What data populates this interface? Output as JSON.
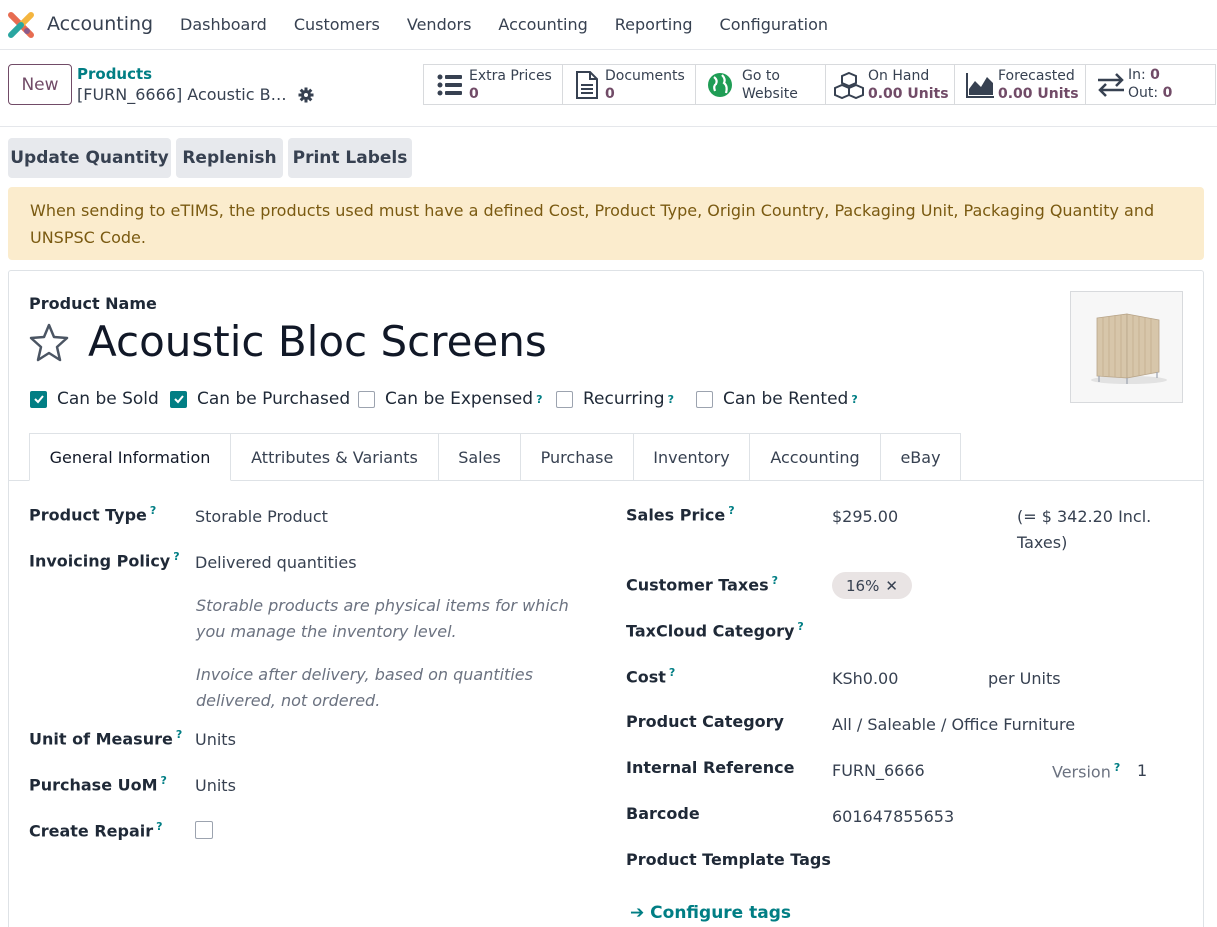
{
  "nav": {
    "app_name": "Accounting",
    "menu": [
      "Dashboard",
      "Customers",
      "Vendors",
      "Accounting",
      "Reporting",
      "Configuration"
    ]
  },
  "control_panel": {
    "new_label": "New",
    "breadcrumb_parent": "Products",
    "breadcrumb_current": "[FURN_6666] Acoustic B…",
    "smart_buttons": {
      "extra_prices": {
        "label": "Extra Prices",
        "value": "0"
      },
      "documents": {
        "label": "Documents",
        "value": "0"
      },
      "website": {
        "line1": "Go to",
        "line2": "Website"
      },
      "on_hand": {
        "label": "On Hand",
        "value": "0.00 Units"
      },
      "forecasted": {
        "label": "Forecasted",
        "value": "0.00 Units"
      },
      "in_out": {
        "in_label": "In:",
        "in_value": "0",
        "out_label": "Out:",
        "out_value": "0"
      }
    }
  },
  "actions": {
    "update_quantity": "Update Quantity",
    "replenish": "Replenish",
    "print_labels": "Print Labels"
  },
  "alert": "When sending to eTIMS, the products used must have a defined Cost, Product Type, Origin Country, Packaging Unit, Packaging Quantity and UNSPSC Code.",
  "product": {
    "name_label": "Product Name",
    "name": "Acoustic Bloc Screens",
    "checkboxes": [
      {
        "label": "Can be Sold",
        "checked": true,
        "help": false
      },
      {
        "label": "Can be Purchased",
        "checked": true,
        "help": false
      },
      {
        "label": "Can be Expensed",
        "checked": false,
        "help": true
      },
      {
        "label": "Recurring",
        "checked": false,
        "help": true
      },
      {
        "label": "Can be Rented",
        "checked": false,
        "help": true
      }
    ]
  },
  "tabs": [
    "General Information",
    "Attributes & Variants",
    "Sales",
    "Purchase",
    "Inventory",
    "Accounting",
    "eBay"
  ],
  "general": {
    "product_type": {
      "label": "Product Type",
      "value": "Storable Product"
    },
    "invoicing_policy": {
      "label": "Invoicing Policy",
      "value": "Delivered quantities"
    },
    "help1": "Storable products are physical items for which you manage the inventory level.",
    "help2": "Invoice after delivery, based on quantities delivered, not ordered.",
    "uom": {
      "label": "Unit of Measure",
      "value": "Units"
    },
    "purchase_uom": {
      "label": "Purchase UoM",
      "value": "Units"
    },
    "create_repair": {
      "label": "Create Repair",
      "checked": false
    },
    "sales_price": {
      "label": "Sales Price",
      "value": "$295.00",
      "incl": "(= $ 342.20 Incl.",
      "incl2": "Taxes)"
    },
    "customer_taxes": {
      "label": "Customer Taxes",
      "tag": "16%"
    },
    "taxcloud": {
      "label": "TaxCloud Category"
    },
    "cost": {
      "label": "Cost",
      "value": "KSh0.00",
      "per": "per Units"
    },
    "category": {
      "label": "Product Category",
      "value": "All / Saleable / Office Furniture"
    },
    "internal_ref": {
      "label": "Internal Reference",
      "value": "FURN_6666",
      "version_label": "Version",
      "version_value": "1"
    },
    "barcode": {
      "label": "Barcode",
      "value": "601647855653"
    },
    "template_tags": {
      "label": "Product Template Tags"
    },
    "configure_tags": "Configure tags"
  }
}
